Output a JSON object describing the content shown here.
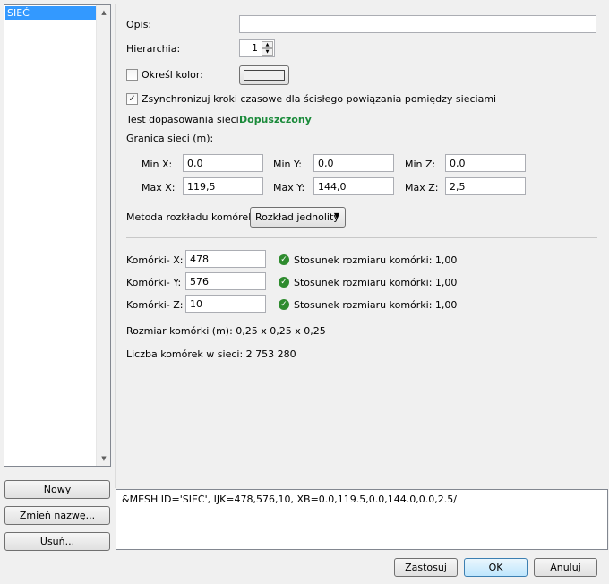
{
  "list": {
    "items": [
      "SIEĆ"
    ]
  },
  "left_buttons": {
    "new": "Nowy",
    "rename": "Zmień nazwę...",
    "delete": "Usuń..."
  },
  "form": {
    "description_label": "Opis:",
    "description_value": "",
    "hierarchy_label": "Hierarchia:",
    "hierarchy_value": "1",
    "color_label": "Określ kolor:",
    "color_checked": false,
    "sync_label": "Zsynchronizuj kroki czasowe dla ścisłego powiązania pomiędzy sieciami",
    "sync_checked": true,
    "fit_test_label": "Test dopasowania sieci:",
    "fit_test_value": "Dopuszczony",
    "fit_test_color": "#1a8a3a",
    "bounds_label": "Granica sieci (m):",
    "bounds": {
      "min_x_label": "Min X:",
      "min_x": "0,0",
      "min_y_label": "Min Y:",
      "min_y": "0,0",
      "min_z_label": "Min Z:",
      "min_z": "0,0",
      "max_x_label": "Max X:",
      "max_x": "119,5",
      "max_y_label": "Max Y:",
      "max_y": "144,0",
      "max_z_label": "Max Z:",
      "max_z": "2,5"
    },
    "method_label": "Metoda rozkładu komórek:",
    "method_value": "Rozkład jednolity",
    "cells": {
      "x_label": "Komórki- X:",
      "x_value": "478",
      "x_ratio": "Stosunek rozmiaru komórki: 1,00",
      "y_label": "Komórki- Y:",
      "y_value": "576",
      "y_ratio": "Stosunek rozmiaru komórki: 1,00",
      "z_label": "Komórki- Z:",
      "z_value": "10",
      "z_ratio": "Stosunek rozmiaru komórki: 1,00"
    },
    "cell_size": "Rozmiar komórki (m): 0,25 x 0,25 x 0,25",
    "cell_count": "Liczba komórek w  sieci: 2 753 280"
  },
  "preview_text": "&MESH ID='SIEĆ', IJK=478,576,10, XB=0.0,119.5,0.0,144.0,0.0,2.5/",
  "dialog_buttons": {
    "apply": "Zastosuj",
    "ok": "OK",
    "cancel": "Anuluj"
  }
}
